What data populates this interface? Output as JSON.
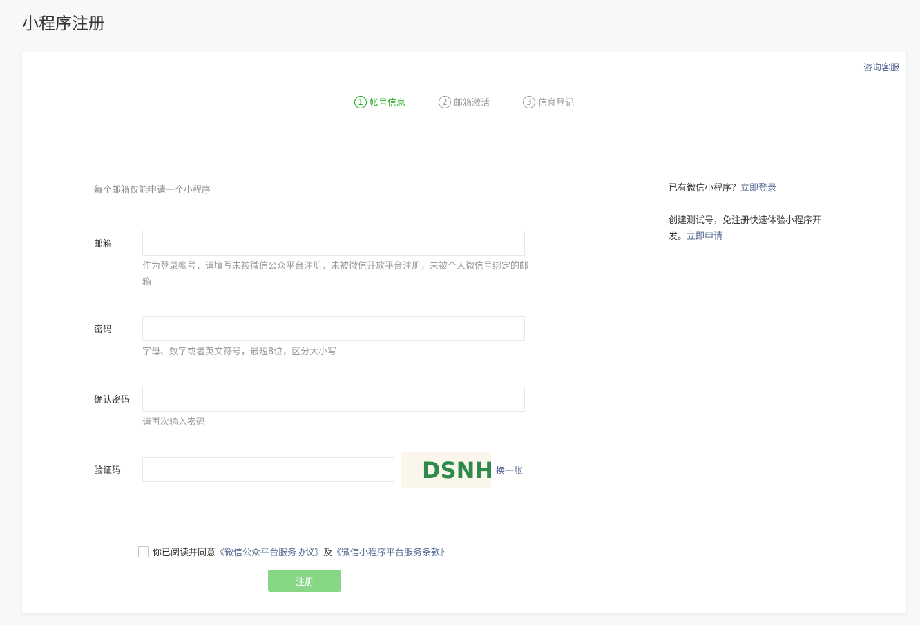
{
  "page_title": "小程序注册",
  "support_link": "咨询客服",
  "steps": [
    {
      "num": "1",
      "label": "帐号信息",
      "active": true
    },
    {
      "num": "2",
      "label": "邮箱激活",
      "active": false
    },
    {
      "num": "3",
      "label": "信息登记",
      "active": false
    }
  ],
  "intro": "每个邮箱仅能申请一个小程序",
  "form": {
    "email": {
      "label": "邮箱",
      "value": "",
      "tip": "作为登录帐号，请填写未被微信公众平台注册，未被微信开放平台注册，未被个人微信号绑定的邮箱"
    },
    "password": {
      "label": "密码",
      "value": "",
      "tip": "字母、数字或者英文符号，最短8位，区分大小写"
    },
    "confirm_password": {
      "label": "确认密码",
      "value": "",
      "tip": "请再次输入密码"
    },
    "captcha": {
      "label": "验证码",
      "value": "",
      "image_text": "DSNH",
      "refresh": "换一张"
    }
  },
  "agreement": {
    "prefix": "你已阅读并同意",
    "link1": "《微信公众平台服务协议》",
    "middle": "及",
    "link2": "《微信小程序平台服务条款》"
  },
  "submit_label": "注册",
  "side": {
    "has_app_text": "已有微信小程序？",
    "login_link": "立即登录",
    "test_text": "创建测试号，免注册快速体验小程序开发。",
    "apply_link": "立即申请"
  },
  "colors": {
    "accent": "#1aad19",
    "link": "#576b95",
    "button_disabled": "#87d786",
    "captcha_text": "#2d8a4a"
  }
}
